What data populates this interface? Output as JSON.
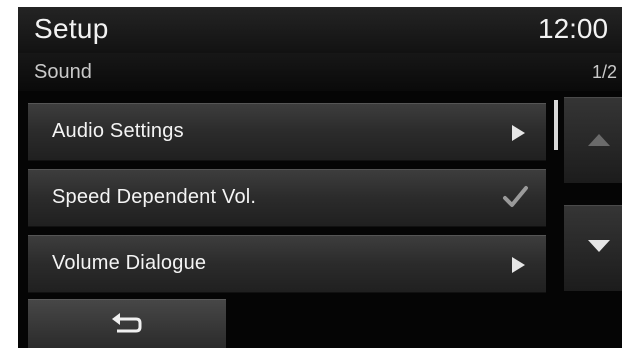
{
  "header": {
    "title": "Setup",
    "time": "12:00"
  },
  "subheader": {
    "section": "Sound",
    "page": "1/2"
  },
  "menu": {
    "items": [
      {
        "label": "Audio Settings",
        "indicator": "chevron-right-icon"
      },
      {
        "label": "Speed Dependent Vol.",
        "indicator": "checkmark-icon",
        "checked": true
      },
      {
        "label": "Volume Dialogue",
        "indicator": "chevron-right-icon"
      }
    ]
  },
  "scroll": {
    "up_icon": "triangle-up-icon",
    "down_icon": "triangle-down-icon"
  },
  "footer": {
    "back_icon": "return-arrow-icon"
  },
  "colors": {
    "background": "#050505",
    "button": "#2b2b2b",
    "text": "#f4f4f4"
  }
}
